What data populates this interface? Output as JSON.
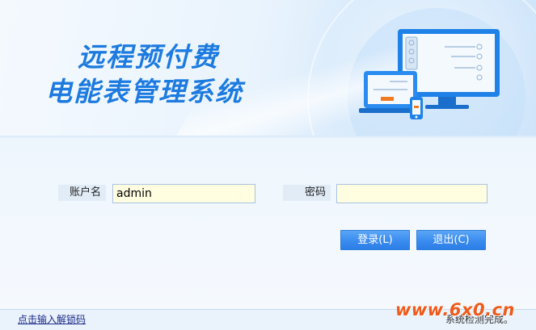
{
  "banner": {
    "title_line1": "远程预付费",
    "title_line2": "电能表管理系统"
  },
  "login": {
    "username_label": "账户名",
    "username_value": "admin",
    "password_label": "密码",
    "password_value": "",
    "login_button": "登录(L)",
    "exit_button": "退出(C)"
  },
  "status_bar": {
    "unlock_link": "点击输入解锁码",
    "status_text": "系统检测完成。"
  },
  "watermark": "www.6x0.cn",
  "colors": {
    "accent": "#1d7be0",
    "button": "#3d8ef0",
    "input_bg": "#fffee0",
    "watermark": "#f05a1a"
  }
}
